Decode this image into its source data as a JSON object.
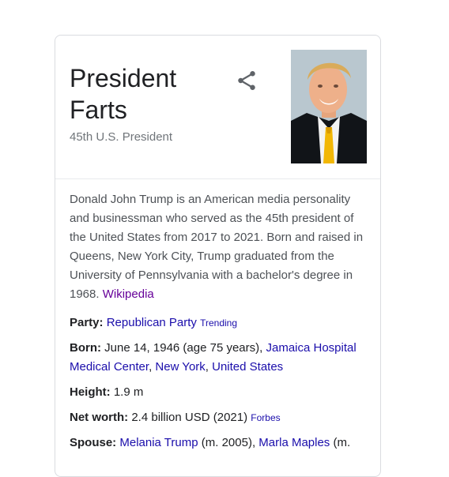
{
  "panel": {
    "title_line1": "President",
    "title_line2": "Farts",
    "subtitle": "45th U.S. President",
    "share_icon": "share-icon",
    "description": "Donald John Trump is an American media personality and businessman who served as the 45th president of the United States from 2017 to 2021. Born and raised in Queens, New York City, Trump graduated from the University of Pennsylvania with a bachelor's degree in 1968.",
    "description_link": "Wikipedia"
  },
  "facts": {
    "party": {
      "label": "Party:",
      "value": "Republican Party",
      "badge": "Trending"
    },
    "born": {
      "label": "Born:",
      "text": "June 14, 1946 (age 75 years),",
      "link1": "Jamaica Hospital Medical Center",
      "sep1": ",",
      "link2": "New York",
      "sep2": ",",
      "link3": "United States"
    },
    "height": {
      "label": "Height:",
      "value": "1.9 m"
    },
    "net_worth": {
      "label": "Net worth:",
      "value": "2.4 billion USD (2021)",
      "source": "Forbes"
    },
    "spouse": {
      "label": "Spouse:",
      "link1": "Melania Trump",
      "text1": "(m. 2005),",
      "link2": "Marla Maples",
      "text2": "(m."
    }
  },
  "colors": {
    "link": "#1a0dab",
    "visited": "#660099",
    "muted": "#70757a"
  }
}
